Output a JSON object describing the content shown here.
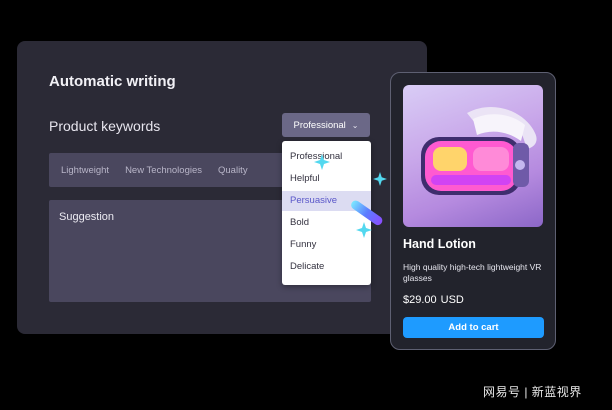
{
  "editor": {
    "title": "Automatic writing",
    "product_keywords_label": "Product keywords",
    "tone_select": {
      "value": "Professional"
    },
    "keywords": [
      "Lightweight",
      "New Technologies",
      "Quality"
    ],
    "suggestion_label": "Suggestion",
    "tone_options": [
      "Professional",
      "Helpful",
      "Persuasive",
      "Bold",
      "Funny",
      "Delicate"
    ],
    "active_tone": "Persuasive"
  },
  "product_card": {
    "name": "Hand Lotion",
    "description": "High quality high-tech lightweight VR glasses",
    "price": "$29.00",
    "currency": "USD",
    "cta": "Add to cart"
  },
  "watermark": "网易号 | 新蓝视界",
  "colors": {
    "panel": "#2b2a36",
    "select": "#6b6887",
    "active_option": "#5a57c9",
    "cart_button": "#1e9bff"
  }
}
